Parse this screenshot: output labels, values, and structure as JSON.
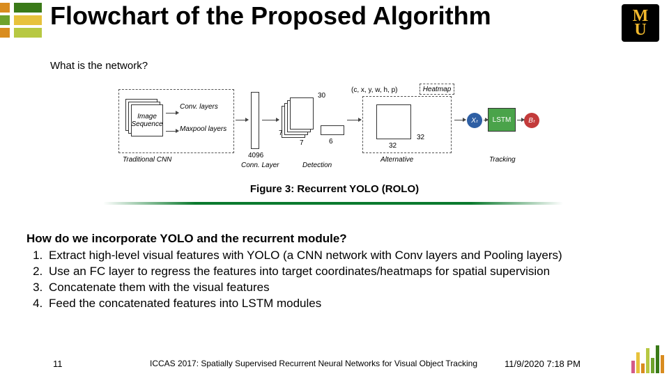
{
  "title": "Flowchart of the Proposed Algorithm",
  "sub_question": "What is the network?",
  "caption": "Figure 3: Recurrent YOLO (ROLO)",
  "section_question": "How do we incorporate YOLO and the recurrent module?",
  "steps": [
    "Extract high-level visual features with YOLO (a CNN network with Conv layers and Pooling layers)",
    "Use an FC layer to regress the features into target coordinates/heatmaps for spatial supervision",
    "Concatenate them with the visual features",
    "Feed the concatenated features into LSTM modules"
  ],
  "diagram": {
    "img_seq": "Image Sequence",
    "trad_cnn": "Traditional CNN",
    "conv": "Conv. layers",
    "maxpool": "Maxpool layers",
    "conn_layer": "Conn. Layer",
    "n4096": "4096",
    "n7a": "7",
    "n7b": "7",
    "n30": "30",
    "n6": "6",
    "n32a": "32",
    "n32b": "32",
    "tuple": "(c, x, y, w, h, p)",
    "heatmap": "Heatmap",
    "detection": "Detection",
    "alternative": "Alternative",
    "tracking": "Tracking",
    "x_t": "Xₜ",
    "lstm": "LSTM",
    "b_t": "Bₜ"
  },
  "footer": {
    "page": "11",
    "center": "ICCAS 2017: Spatially Supervised Recurrent Neural Networks for Visual Object Tracking",
    "date": "11/9/2020 7:18 PM"
  },
  "colors": {
    "orange": "#d98c1f",
    "green": "#6fa22c",
    "dgreen": "#3a7a18",
    "yellow": "#e7c23c",
    "lime": "#b7c842",
    "pink": "#d45a88",
    "blue": "#2e5fa4",
    "bgreen": "#4aa34a",
    "red": "#c33b3b"
  }
}
